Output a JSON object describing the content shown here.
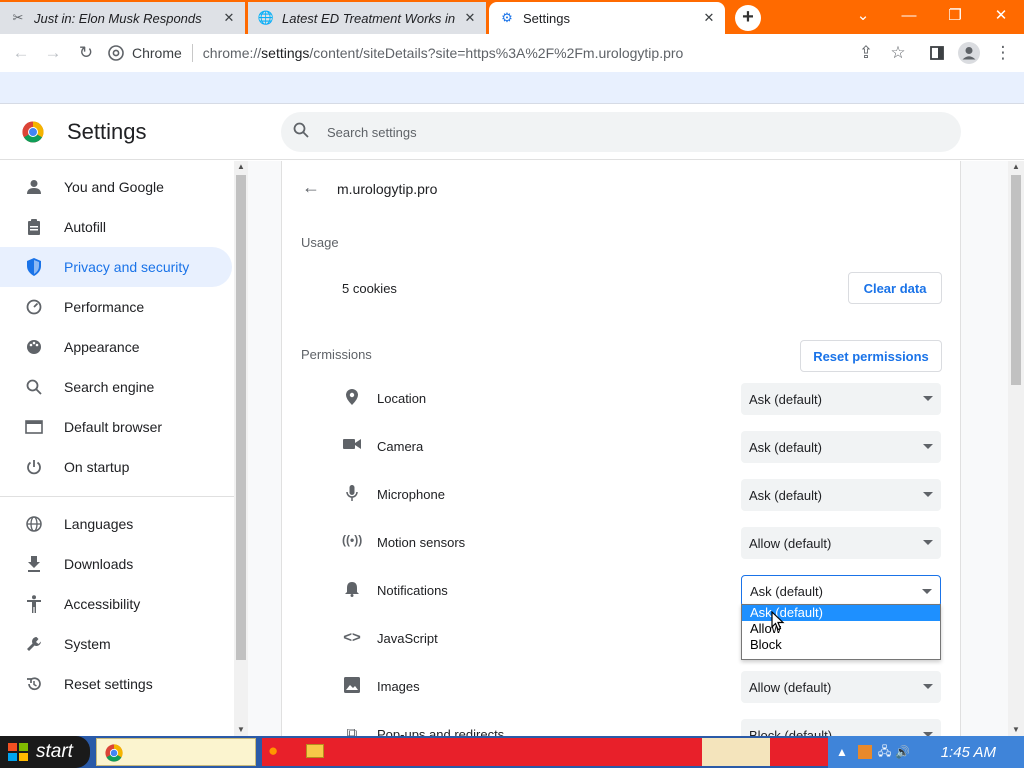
{
  "browser": {
    "tabs": [
      {
        "title": "Just in: Elon Musk Responds",
        "close": "✕"
      },
      {
        "title": "Latest ED Treatment Works in",
        "close": "✕"
      },
      {
        "title": "Settings",
        "close": "✕"
      }
    ],
    "new_tab": "+",
    "window_controls": {
      "dropdown": "⌄",
      "minimize": "—",
      "restore": "❐",
      "close": "✕"
    },
    "omnibox": {
      "chip": "Chrome",
      "url_prefix": "chrome://",
      "url_main": "settings",
      "url_rest": "/content/siteDetails?site=https%3A%2F%2Fm.urologytip.pro"
    }
  },
  "settings": {
    "title": "Settings",
    "search_placeholder": "Search settings",
    "nav": [
      {
        "label": "You and Google",
        "icon": "person-icon"
      },
      {
        "label": "Autofill",
        "icon": "clipboard-icon"
      },
      {
        "label": "Privacy and security",
        "icon": "shield-icon"
      },
      {
        "label": "Performance",
        "icon": "gauge-icon"
      },
      {
        "label": "Appearance",
        "icon": "palette-icon"
      },
      {
        "label": "Search engine",
        "icon": "search-icon"
      },
      {
        "label": "Default browser",
        "icon": "browser-icon"
      },
      {
        "label": "On startup",
        "icon": "power-icon"
      },
      {
        "label": "Languages",
        "icon": "globe-icon"
      },
      {
        "label": "Downloads",
        "icon": "download-icon"
      },
      {
        "label": "Accessibility",
        "icon": "accessibility-icon"
      },
      {
        "label": "System",
        "icon": "wrench-icon"
      },
      {
        "label": "Reset settings",
        "icon": "history-icon"
      }
    ],
    "active_nav": "Privacy and security"
  },
  "site": {
    "name": "m.urologytip.pro",
    "usage_heading": "Usage",
    "cookies": "5 cookies",
    "clear_data": "Clear data",
    "permissions_heading": "Permissions",
    "reset_permissions": "Reset permissions",
    "permissions": [
      {
        "label": "Location",
        "value": "Ask (default)",
        "icon": "location-pin-icon"
      },
      {
        "label": "Camera",
        "value": "Ask (default)",
        "icon": "camera-icon"
      },
      {
        "label": "Microphone",
        "value": "Ask (default)",
        "icon": "microphone-icon"
      },
      {
        "label": "Motion sensors",
        "value": "Allow (default)",
        "icon": "motion-sensor-icon"
      },
      {
        "label": "Notifications",
        "value": "Ask (default)",
        "icon": "bell-icon"
      },
      {
        "label": "JavaScript",
        "value": "",
        "icon": "code-icon"
      },
      {
        "label": "Images",
        "value": "Allow (default)",
        "icon": "image-icon"
      },
      {
        "label": "Pop-ups and redirects",
        "value": "Block (default)",
        "icon": "popup-icon"
      }
    ],
    "dropdown_options": [
      "Ask (default)",
      "Allow",
      "Block"
    ],
    "dropdown_selected": "Ask (default)"
  },
  "taskbar": {
    "start": "start",
    "time": "1:45 AM"
  },
  "colors": {
    "tabstrip": "#ff6a00",
    "accent": "#1a73e8",
    "taskbar": "#2a5aa8"
  }
}
